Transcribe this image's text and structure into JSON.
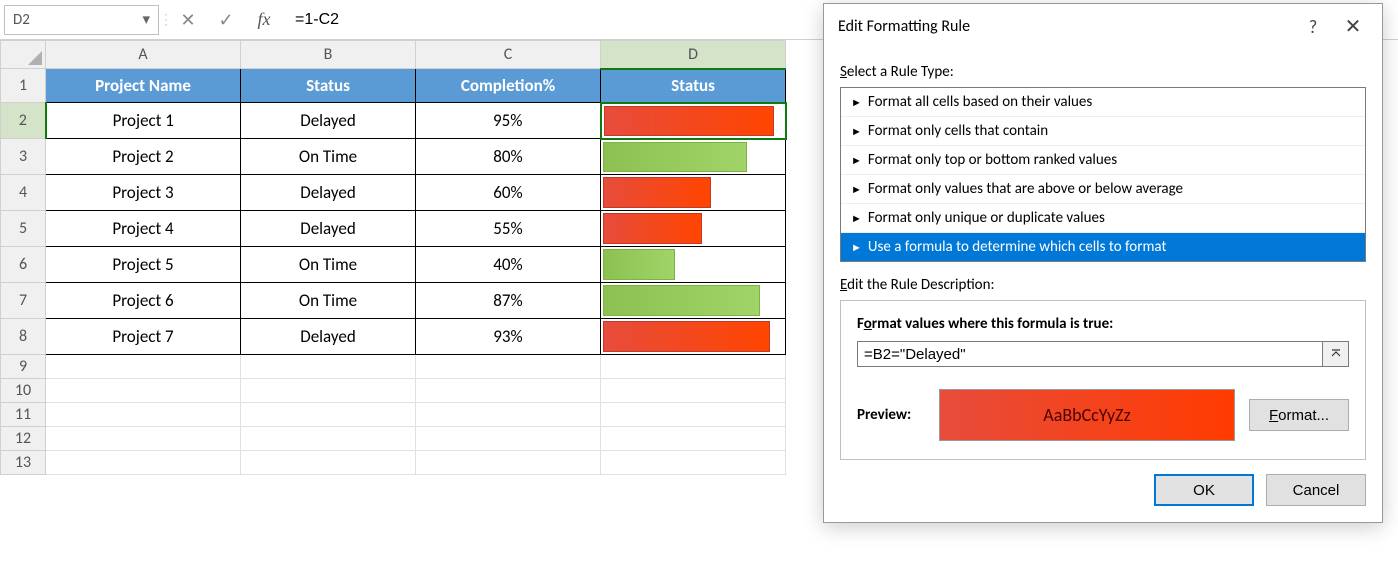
{
  "formula_bar": {
    "name_box": "D2",
    "formula": "=1-C2"
  },
  "columns": [
    "A",
    "B",
    "C",
    "D"
  ],
  "selected_column": "D",
  "selected_row": 2,
  "rows": [
    1,
    2,
    3,
    4,
    5,
    6,
    7,
    8,
    9,
    10,
    11,
    12,
    13
  ],
  "headers": {
    "project_name": "Project Name",
    "status": "Status",
    "completion": "Completion%",
    "status2": "Status"
  },
  "chart_data": {
    "type": "table",
    "columns": [
      "Project Name",
      "Status",
      "Completion%",
      "Status"
    ],
    "rows": [
      {
        "project": "Project 1",
        "status": "Delayed",
        "completion": 95,
        "bar_color": "red"
      },
      {
        "project": "Project 2",
        "status": "On Time",
        "completion": 80,
        "bar_color": "green"
      },
      {
        "project": "Project 3",
        "status": "Delayed",
        "completion": 60,
        "bar_color": "red"
      },
      {
        "project": "Project 4",
        "status": "Delayed",
        "completion": 55,
        "bar_color": "red"
      },
      {
        "project": "Project 5",
        "status": "On Time",
        "completion": 40,
        "bar_color": "green"
      },
      {
        "project": "Project 6",
        "status": "On Time",
        "completion": 87,
        "bar_color": "green"
      },
      {
        "project": "Project 7",
        "status": "Delayed",
        "completion": 93,
        "bar_color": "red"
      }
    ]
  },
  "dialog": {
    "title": "Edit Formatting Rule",
    "rule_type_label": "Select a Rule Type:",
    "rule_types": [
      "Format all cells based on their values",
      "Format only cells that contain",
      "Format only top or bottom ranked values",
      "Format only values that are above or below average",
      "Format only unique or duplicate values",
      "Use a formula to determine which cells to format"
    ],
    "selected_rule_index": 5,
    "edit_desc_label": "Edit the Rule Description:",
    "formula_label": "Format values where this formula is true:",
    "formula_value": "=B2=\"Delayed\"",
    "preview_label": "Preview:",
    "preview_text": "AaBbCcYyZz",
    "format_btn": "Format...",
    "ok_btn": "OK",
    "cancel_btn": "Cancel"
  }
}
